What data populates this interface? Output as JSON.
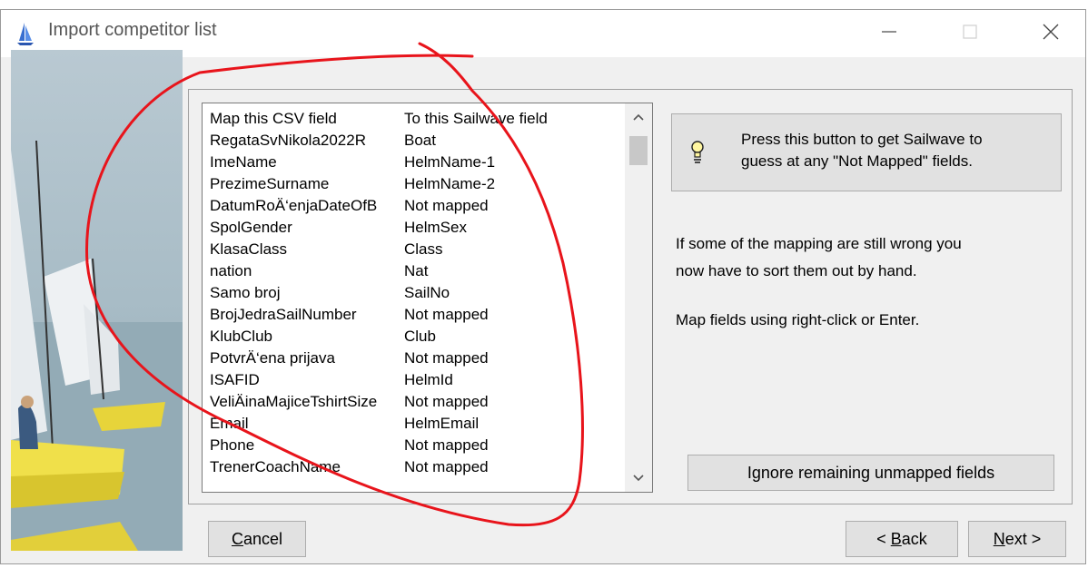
{
  "window": {
    "title": "Import competitor list"
  },
  "list": {
    "header_csv": "Map this CSV field",
    "header_sailwave": "To this Sailwave field",
    "rows": [
      {
        "csv": "RegataSvNikola2022R",
        "sailwave": "Boat"
      },
      {
        "csv": "ImeName",
        "sailwave": "HelmName-1"
      },
      {
        "csv": "PrezimeSurname",
        "sailwave": "HelmName-2"
      },
      {
        "csv": "DatumRoÄ‘enjaDateOfB",
        "sailwave": "Not mapped"
      },
      {
        "csv": "SpolGender",
        "sailwave": "HelmSex"
      },
      {
        "csv": "KlasaClass",
        "sailwave": "Class"
      },
      {
        "csv": "nation",
        "sailwave": "Nat"
      },
      {
        "csv": "Samo broj",
        "sailwave": "SailNo"
      },
      {
        "csv": "BrojJedraSailNumber",
        "sailwave": "Not mapped"
      },
      {
        "csv": "KlubClub",
        "sailwave": "Club"
      },
      {
        "csv": "PotvrÄ‘ena prijava",
        "sailwave": "Not mapped"
      },
      {
        "csv": "ISAFID",
        "sailwave": "HelmId"
      },
      {
        "csv": "VeliÄinaMajiceTshirtSize",
        "sailwave": "Not mapped"
      },
      {
        "csv": "Email",
        "sailwave": "HelmEmail"
      },
      {
        "csv": "Phone",
        "sailwave": "Not mapped"
      },
      {
        "csv": "TrenerCoachName",
        "sailwave": "Not mapped"
      }
    ]
  },
  "guess_button": {
    "line1": "Press this button to get Sailwave to",
    "line2": "guess at any \"Not Mapped\" fields."
  },
  "info": {
    "line1": "If some of the mapping are still wrong you",
    "line2": "now have to sort them out by hand.",
    "line3": "Map fields using right-click or Enter."
  },
  "buttons": {
    "ignore": "Ignore remaining unmapped fields",
    "cancel_mnemonic": "C",
    "cancel_rest": "ancel",
    "back_prefix": "< ",
    "back_mnemonic": "B",
    "back_rest": "ack",
    "next_mnemonic": "N",
    "next_rest": "ext >"
  },
  "colors": {
    "annotation": "#e8141b",
    "window_bg": "#f0f0f0",
    "button_bg": "#e1e1e1"
  }
}
